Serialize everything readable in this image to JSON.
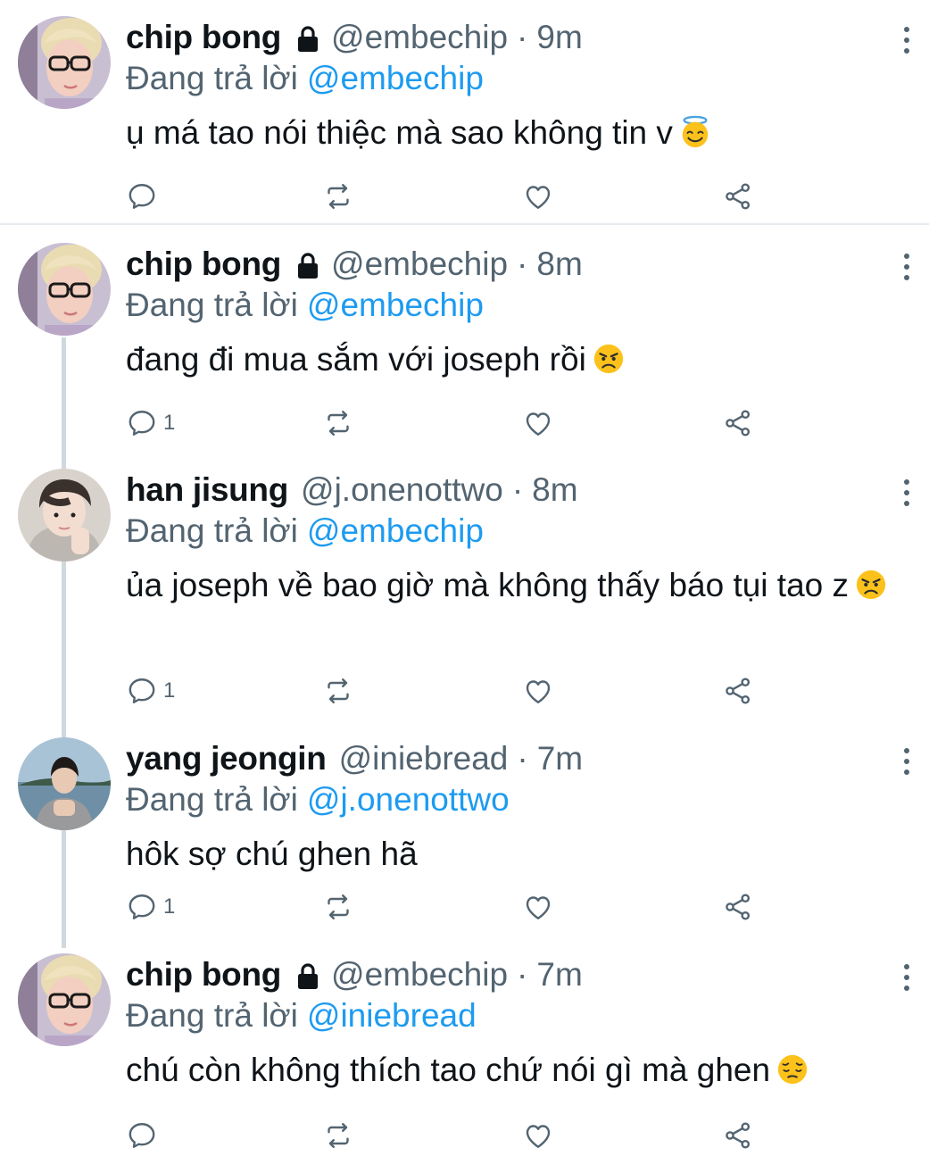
{
  "tweets": [
    {
      "name": "chip bong",
      "locked": true,
      "handle": "@embechip",
      "time": "9m",
      "replying_label": "Đang trả lời",
      "replying_to": "@embechip",
      "text": "ụ má tao nói thiệc mà sao không tin v",
      "emoji": "smiling-face-with-halo",
      "reply_count": "",
      "avatar": "blonde-glasses"
    },
    {
      "name": "chip bong",
      "locked": true,
      "handle": "@embechip",
      "time": "8m",
      "replying_label": "Đang trả lời",
      "replying_to": "@embechip",
      "text": "đang đi mua sắm với joseph rồi",
      "emoji": "angry-face",
      "reply_count": "1",
      "avatar": "blonde-glasses"
    },
    {
      "name": "han jisung",
      "locked": false,
      "handle": "@j.onenottwo",
      "time": "8m",
      "replying_label": "Đang trả lời",
      "replying_to": "@embechip",
      "text": "ủa joseph về bao giờ mà không thấy báo tụi tao z",
      "emoji": "angry-face",
      "reply_count": "1",
      "avatar": "dark-hair-hoodie"
    },
    {
      "name": "yang jeongin",
      "locked": false,
      "handle": "@iniebread",
      "time": "7m",
      "replying_label": "Đang trả lời",
      "replying_to": "@j.onenottwo",
      "text": "hôk sợ chú ghen hã",
      "emoji": "",
      "reply_count": "1",
      "avatar": "seaside-hoodie"
    },
    {
      "name": "chip bong",
      "locked": true,
      "handle": "@embechip",
      "time": "7m",
      "replying_label": "Đang trả lời",
      "replying_to": "@iniebread",
      "text": "chú còn không thích tao chứ nói gì mà ghen",
      "emoji": "pensive-face",
      "reply_count": "",
      "avatar": "blonde-glasses"
    }
  ],
  "icons": {
    "reply": "reply-icon",
    "retweet": "retweet-icon",
    "like": "like-icon",
    "share": "share-icon",
    "more": "more-options-icon",
    "lock": "lock-icon"
  },
  "colors": {
    "text": "#0f1419",
    "secondary": "#536471",
    "link": "#1d9bf0",
    "divider": "#e6ecf0",
    "thread_line": "#cfd9de"
  }
}
